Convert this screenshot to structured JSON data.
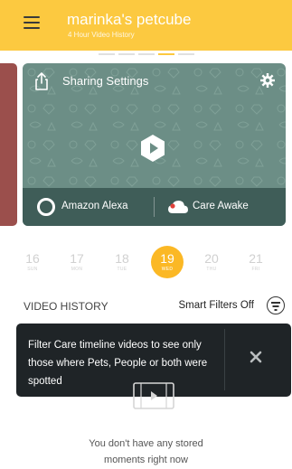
{
  "header": {
    "title": "marinka's petcube",
    "subtitle": "4 Hour Video History"
  },
  "camera_card": {
    "sharing_label": "Sharing Settings",
    "alexa_label": "Amazon Alexa",
    "care_label": "Care Awake"
  },
  "dates": [
    {
      "num": "16",
      "day": "SUN"
    },
    {
      "num": "17",
      "day": "MON"
    },
    {
      "num": "18",
      "day": "TUE"
    },
    {
      "num": "19",
      "day": "WED"
    },
    {
      "num": "20",
      "day": "THU"
    },
    {
      "num": "21",
      "day": "FRI"
    }
  ],
  "video_history": {
    "title": "VIDEO HISTORY",
    "filters_label": "Smart Filters Off"
  },
  "tooltip": {
    "text": "Filter Care timeline videos to see only those where Pets, People or both were spotted"
  },
  "empty_state": {
    "line1": "You don't have any stored",
    "line2": "moments right now"
  },
  "colors": {
    "accent": "#fcc940",
    "date_selected": "#fbb825",
    "card_bg": "#6c8e86",
    "card_footer": "#3f5d58",
    "tooltip_bg": "#1f2427",
    "care_dot": "#e0413a"
  },
  "icons": [
    "menu-icon",
    "share-icon",
    "gear-icon",
    "play-icon",
    "alexa-icon",
    "cloud-icon",
    "filter-icon",
    "close-icon",
    "film-icon"
  ]
}
